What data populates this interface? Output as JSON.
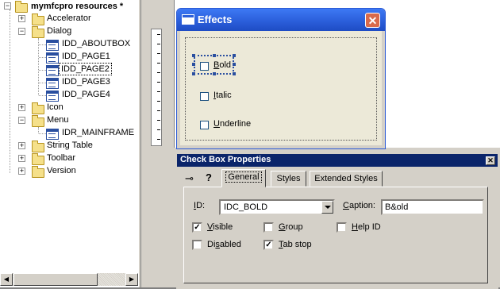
{
  "tree": {
    "root": "mymfcpro resources *",
    "items": [
      {
        "label": "Accelerator",
        "level": 1,
        "expander": "+"
      },
      {
        "label": "Dialog",
        "level": 1,
        "expander": "-"
      },
      {
        "label": "IDD_ABOUTBOX",
        "level": 2
      },
      {
        "label": "IDD_PAGE1",
        "level": 2
      },
      {
        "label": "IDD_PAGE2",
        "level": 2,
        "selected": true
      },
      {
        "label": "IDD_PAGE3",
        "level": 2
      },
      {
        "label": "IDD_PAGE4",
        "level": 2
      },
      {
        "label": "Icon",
        "level": 1,
        "expander": "+"
      },
      {
        "label": "Menu",
        "level": 1,
        "expander": "-"
      },
      {
        "label": "IDR_MAINFRAME",
        "level": 2
      },
      {
        "label": "String Table",
        "level": 1,
        "expander": "+"
      },
      {
        "label": "Toolbar",
        "level": 1,
        "expander": "+"
      },
      {
        "label": "Version",
        "level": 1,
        "expander": "+"
      }
    ]
  },
  "dialog": {
    "title": "Effects",
    "checkboxes": [
      {
        "prefix": "",
        "mnemonic": "B",
        "rest": "old"
      },
      {
        "prefix": "",
        "mnemonic": "I",
        "rest": "talic"
      },
      {
        "prefix": "",
        "mnemonic": "U",
        "rest": "nderline"
      }
    ]
  },
  "properties": {
    "title": "Check Box Properties",
    "tabs": [
      "General",
      "Styles",
      "Extended Styles"
    ],
    "active_tab": "General",
    "id_label_m": "I",
    "id_label_r": "D:",
    "id_value": "IDC_BOLD",
    "caption_label_m": "C",
    "caption_label_r": "aption:",
    "caption_value": "B&old",
    "options": [
      {
        "pre": "",
        "m": "V",
        "post": "isible",
        "checked": true
      },
      {
        "pre": "",
        "m": "G",
        "post": "roup",
        "checked": false
      },
      {
        "pre": "",
        "m": "H",
        "post": "elp ID",
        "checked": false
      },
      {
        "pre": "Di",
        "m": "s",
        "post": "abled",
        "checked": false
      },
      {
        "pre": "",
        "m": "T",
        "post": "ab stop",
        "checked": true
      }
    ]
  },
  "colors": {
    "accent": "#0a246a",
    "xp_title": "#2b5fdb",
    "close": "#d96a4b"
  },
  "icons": [
    "minus-expander-icon",
    "folder-icon",
    "dialog-resource-icon",
    "pin-icon",
    "help-icon",
    "close-icon"
  ]
}
